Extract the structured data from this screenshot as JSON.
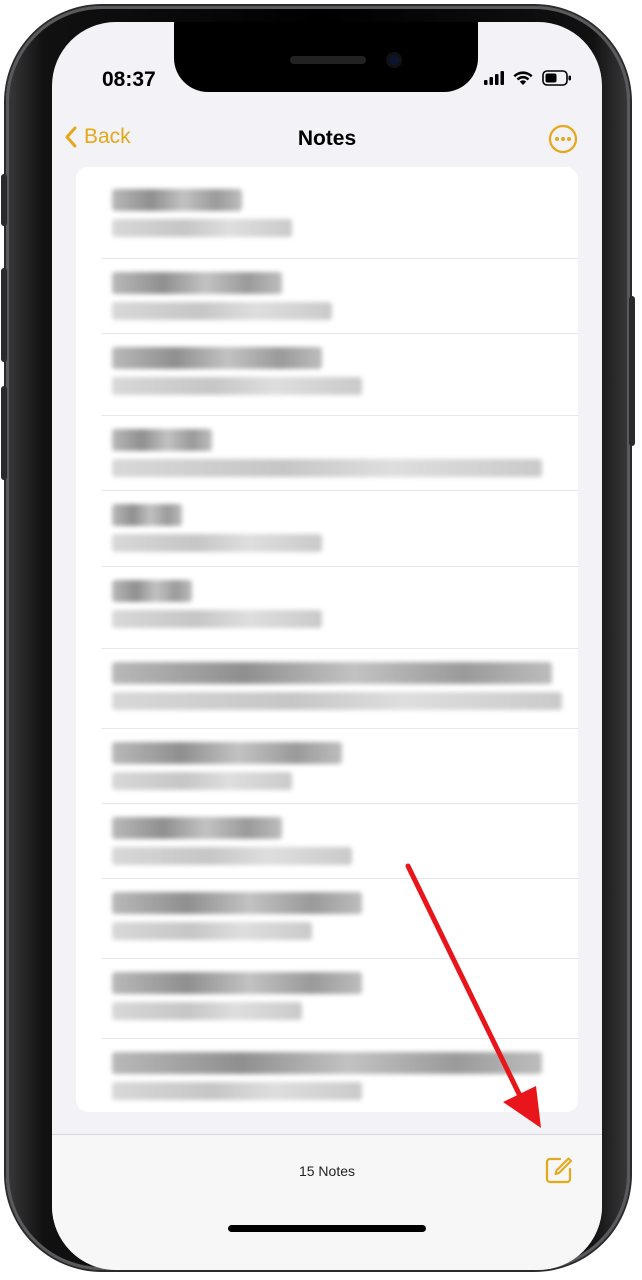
{
  "status_bar": {
    "time": "08:37"
  },
  "nav": {
    "back_label": "Back",
    "title": "Notes"
  },
  "notes_list": {
    "row_count": 12
  },
  "toolbar": {
    "count_label": "15 Notes"
  },
  "colors": {
    "accent": "#e6a818",
    "annotation_arrow": "#e8161b"
  },
  "icons": {
    "back": "chevron-left-icon",
    "more": "ellipsis-circle-icon",
    "compose": "compose-icon",
    "signal": "cellular-signal-icon",
    "wifi": "wifi-icon",
    "battery": "battery-icon"
  }
}
